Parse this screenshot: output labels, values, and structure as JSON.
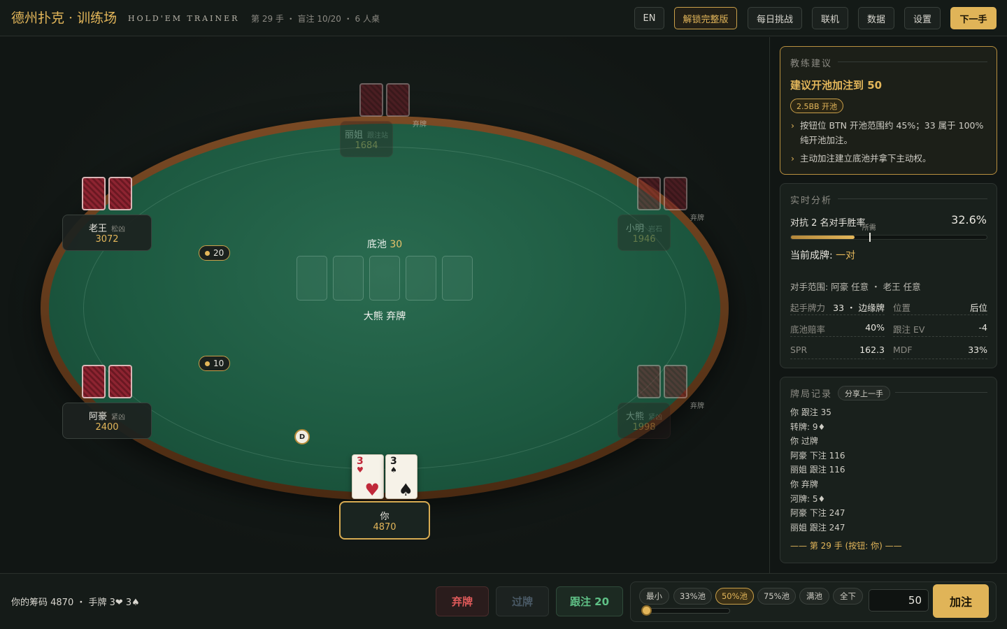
{
  "topbar": {
    "brand": "德州扑克 · 训练场",
    "brand_sub": "HOLD'EM TRAINER",
    "hand_info": "第 29 手 ・ 盲注 10/20 ・ 6 人桌",
    "buttons": {
      "lang": "EN",
      "unlock": "解锁完整版",
      "daily": "每日挑战",
      "online": "联机",
      "stats": "数据",
      "settings": "设置",
      "next": "下一手"
    }
  },
  "table": {
    "pot_label": "底池",
    "pot_value": "30",
    "last_action": "大熊 弃牌",
    "dealer_button": "D",
    "seats": {
      "lijie": {
        "name": "丽姐",
        "tag": "跟注站",
        "stack": "1684",
        "status": "弃牌"
      },
      "laowang": {
        "name": "老王",
        "tag": "松凶",
        "stack": "3072"
      },
      "xiaoming": {
        "name": "小明",
        "tag": "岩石",
        "stack": "1946",
        "status": "弃牌"
      },
      "ahao": {
        "name": "阿豪",
        "tag": "紧凶",
        "stack": "2400"
      },
      "daxiong": {
        "name": "大熊",
        "tag": "紧凶",
        "stack": "1998",
        "status": "弃牌"
      },
      "you": {
        "name": "你",
        "stack": "4870"
      }
    },
    "bets": {
      "laowang": "20",
      "ahao": "10"
    },
    "hero_cards": [
      {
        "rank": "3",
        "suit": "♥",
        "color": "#c0293a"
      },
      {
        "rank": "3",
        "suit": "♠",
        "color": "#1a1a1a"
      }
    ]
  },
  "coach": {
    "title": "教练建议",
    "headline": "建议开池加注到 50",
    "badge": "2.5BB 开池",
    "points": [
      "按钮位 BTN 开池范围约 45%；33 属于 100% 纯开池加注。",
      "主动加注建立底池并拿下主动权。"
    ]
  },
  "analysis": {
    "title": "实时分析",
    "equity_label": "对抗 2 名对手胜率",
    "equity_value": "32.6%",
    "equity": 0.326,
    "required_label": "所需",
    "required": 0.4,
    "made_label": "当前成牌:",
    "made_value": "一对",
    "range": "对手范围: 阿豪 任意 ・ 老王 任意",
    "stats": [
      {
        "k": "起手牌力",
        "v": "33 ・ 边缘牌"
      },
      {
        "k": "位置",
        "v": "后位"
      },
      {
        "k": "底池赔率",
        "v": "40%"
      },
      {
        "k": "跟注 EV",
        "v": "-4"
      },
      {
        "k": "SPR",
        "v": "162.3"
      },
      {
        "k": "MDF",
        "v": "33%"
      }
    ]
  },
  "history": {
    "title": "牌局记录",
    "share": "分享上一手",
    "entries": [
      "你 跟注 35",
      "转牌: 9♦",
      "你 过牌",
      "阿豪 下注 116",
      "丽姐 跟注 116",
      "你 弃牌",
      "河牌: 5♦",
      "阿豪 下注 247",
      "丽姐 跟注 247"
    ],
    "footer": "—— 第 29 手 (按钮: 你) ——"
  },
  "bottom": {
    "stack_info": "你的筹码 4870 ・ 手牌 3❤ 3♠",
    "fold": "弃牌",
    "check": "过牌",
    "call": "跟注 20",
    "presets": [
      "最小",
      "33%池",
      "50%池",
      "75%池",
      "满池",
      "全下"
    ],
    "active_preset": "50%池",
    "slider_value": 0.0,
    "amount": "50",
    "raise": "加注"
  },
  "colors": {
    "accent": "#e3b65a",
    "felt": "#1d5a41",
    "fold": "#e05a5a",
    "call": "#5fc086"
  }
}
